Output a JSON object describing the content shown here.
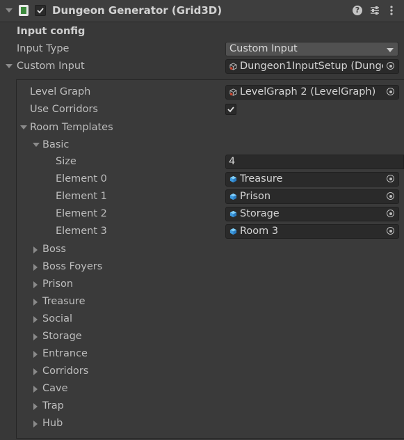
{
  "header": {
    "title": "Dungeon Generator (Grid3D)",
    "enabled": true,
    "icons": [
      "foldout-arrow-icon",
      "script-icon",
      "checkbox-icon",
      "help-icon",
      "preset-icon",
      "kebab-menu-icon"
    ]
  },
  "input_config": {
    "section_title": "Input config",
    "input_type_label": "Input Type",
    "input_type_value": "Custom Input",
    "custom_input_label": "Custom Input",
    "custom_input_value": "Dungeon1InputSetup (Dunge"
  },
  "custom": {
    "level_graph_label": "Level Graph",
    "level_graph_value": "LevelGraph 2 (LevelGraph)",
    "use_corridors_label": "Use Corridors",
    "use_corridors_value": true,
    "room_templates_label": "Room Templates",
    "basic": {
      "label": "Basic",
      "size_label": "Size",
      "size_value": "4",
      "elements": [
        {
          "label": "Element 0",
          "value": "Treasure"
        },
        {
          "label": "Element 1",
          "value": "Prison"
        },
        {
          "label": "Element 2",
          "value": "Storage"
        },
        {
          "label": "Element 3",
          "value": "Room 3"
        }
      ]
    },
    "groups": [
      "Boss",
      "Boss Foyers",
      "Prison",
      "Treasure",
      "Social",
      "Storage",
      "Entrance",
      "Corridors",
      "Cave",
      "Trap",
      "Hub"
    ]
  },
  "colors": {
    "background": "#383838",
    "field": "#2a2a2a",
    "cube": "#4fb3ff"
  }
}
